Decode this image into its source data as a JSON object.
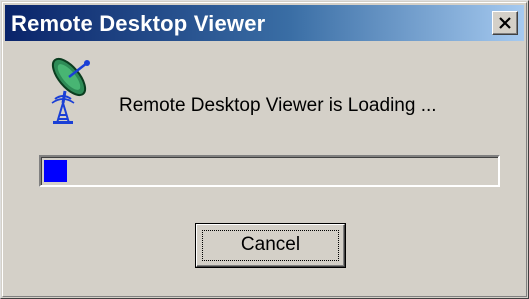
{
  "window": {
    "title": "Remote Desktop Viewer",
    "close_glyph": "X"
  },
  "dialog": {
    "icon": "satellite-dish-icon",
    "message": "Remote Desktop Viewer is Loading ...",
    "progress": {
      "value_fraction": 0.05,
      "fill_color": "#0000ff"
    },
    "cancel_label": "Cancel"
  },
  "colors": {
    "titlebar_start": "#0a246a",
    "titlebar_end": "#a6caf0",
    "face": "#d4d0c8"
  }
}
